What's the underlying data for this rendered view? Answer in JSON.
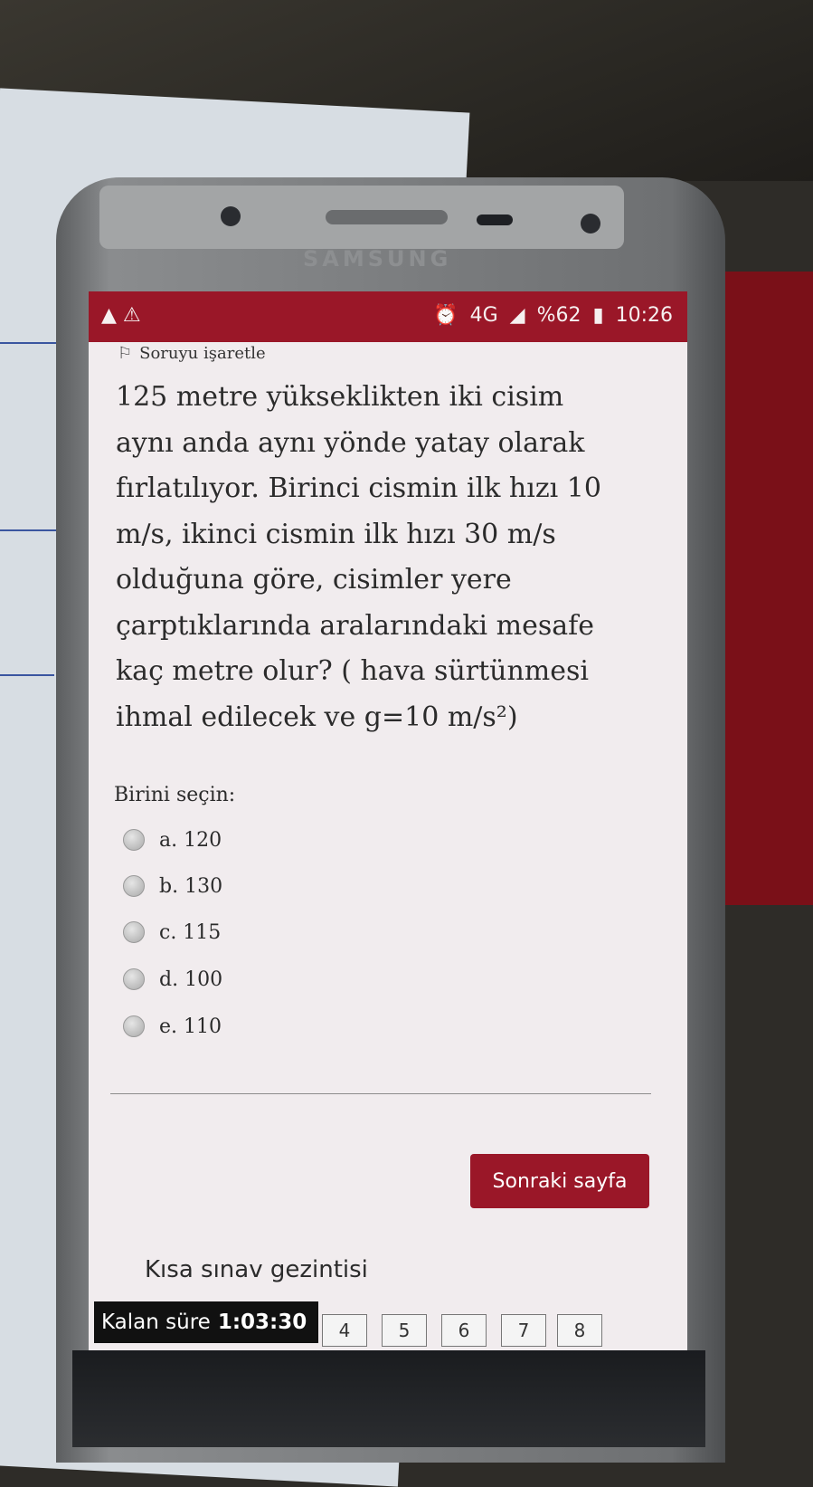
{
  "device": {
    "brand": "SAMSUNG"
  },
  "statusbar": {
    "left_icons": [
      "bag-icon",
      "warning-icon"
    ],
    "network": "4G",
    "battery": "%62",
    "time": "10:26"
  },
  "question": {
    "flag_label": "Soruyu işaretle",
    "lines": [
      "125 metre yükseklikten iki cisim",
      "aynı anda aynı yönde yatay olarak",
      "fırlatılıyor. Birinci cismin ilk hızı 10",
      "m/s, ikinci cismin ilk hızı 30 m/s",
      "olduğuna göre, cisimler yere",
      "çarptıklarında aralarındaki mesafe",
      "kaç metre olur? ( hava sürtünmesi",
      "ihmal edilecek ve g=10 m/s²)"
    ]
  },
  "choices": {
    "prompt": "Birini seçin:",
    "options": [
      "a. 120",
      "b. 130",
      "c. 115",
      "d. 100",
      "e. 110"
    ]
  },
  "next_button": "Sonraki sayfa",
  "quiz_nav": {
    "title": "Kısa sınav gezintisi",
    "timer_label": "Kalan süre",
    "timer_value": "1:03:30",
    "pages": [
      "4",
      "5",
      "6",
      "7",
      "8"
    ]
  }
}
